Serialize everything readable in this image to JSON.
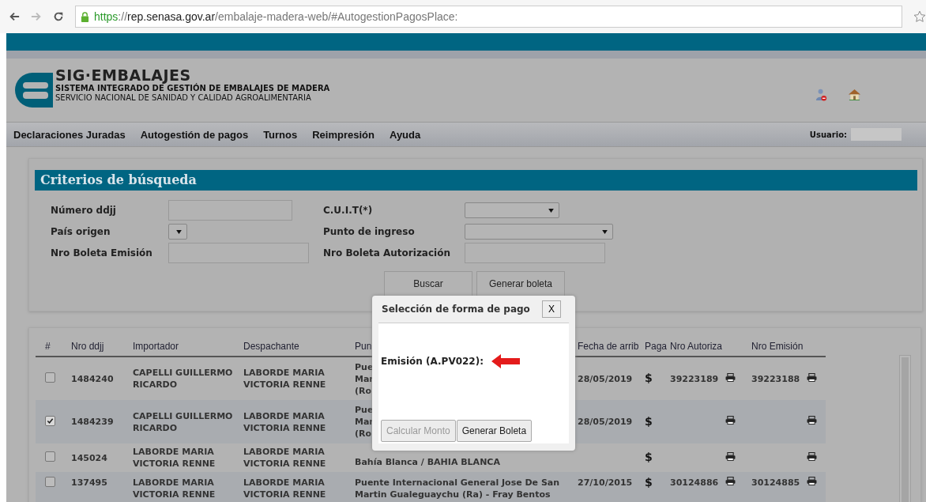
{
  "browser": {
    "url_scheme": "https",
    "url_separator": "://",
    "url_host": "rep.senasa.gov.ar",
    "url_path": "/embalaje-madera-web/#AutogestionPagosPlace:"
  },
  "header": {
    "title": "SIG·EMBALAJES",
    "subtitle": "SISTEMA INTEGRADO DE GESTIÓN DE EMBALAJES DE MADERA",
    "agency": "SERVICIO NACIONAL DE SANIDAD Y CALIDAD AGROALIMENTARIA"
  },
  "menu": [
    "Declaraciones Juradas",
    "Autogestión de pagos",
    "Turnos",
    "Reimpresión",
    "Ayuda"
  ],
  "user": {
    "label": "Usuario:"
  },
  "search": {
    "title": "Criterios de búsqueda",
    "fields": [
      {
        "label": "Número ddjj",
        "kind": "text"
      },
      {
        "label": "C.U.I.T(*)",
        "kind": "select"
      },
      {
        "label": "País origen",
        "kind": "select"
      },
      {
        "label": "Punto de ingreso",
        "kind": "select"
      },
      {
        "label": "Nro Boleta Emisión",
        "kind": "text"
      },
      {
        "label": "Nro Boleta Autorización",
        "kind": "text"
      }
    ],
    "buttons": [
      "Buscar",
      "Generar boleta"
    ]
  },
  "table": {
    "columns": [
      "#",
      "Nro ddjj",
      "Importador",
      "Despachante",
      "Pun",
      "Fecha de arrib",
      "Paga",
      "Nro Autoriza",
      "Nro Emisión"
    ],
    "rows": [
      {
        "checked": false,
        "nro": "1484240",
        "importador": "CAPELLI GUILLERMO RICARDO",
        "despachante": "LABORDE MARIA VICTORIA RENNE",
        "punto": [
          "Pue",
          "Mar",
          "(Ro"
        ],
        "fecha": "28/05/2019",
        "paga": "$",
        "autorizacion": "39223189",
        "emision": "39223188"
      },
      {
        "checked": true,
        "nro": "1484239",
        "importador": "CAPELLI GUILLERMO RICARDO",
        "despachante": "LABORDE MARIA VICTORIA RENNE",
        "punto": [
          "Pue",
          "Mar",
          "(Ro"
        ],
        "fecha": "28/05/2019",
        "paga": "$",
        "autorizacion": "",
        "emision": ""
      },
      {
        "checked": false,
        "nro": "145024",
        "importador": "LABORDE MARIA VICTORIA RENNE",
        "despachante": "LABORDE MARIA VICTORIA RENNE",
        "punto": [
          "Bahía Blanca / BAHIA BLANCA"
        ],
        "fecha": "",
        "paga": "$",
        "autorizacion": "",
        "emision": ""
      },
      {
        "checked": false,
        "nro": "137495",
        "importador": "LABORDE MARIA VICTORIA RENNE",
        "despachante": "LABORDE MARIA VICTORIA RENNE",
        "punto": [
          "Puente Internacional General Jose De San",
          "Martin Gualeguaychu (Ra) - Fray Bentos"
        ],
        "fecha": "27/10/2015",
        "paga": "$",
        "autorizacion": "30124886",
        "emision": "30124885"
      }
    ]
  },
  "dialog": {
    "title": "Selección de forma de pago",
    "close": "X",
    "label": "Emisión (A.PV022):",
    "buttons": [
      {
        "label": "Calcular Monto",
        "disabled": true
      },
      {
        "label": "Generar Boleta",
        "disabled": false
      }
    ]
  }
}
